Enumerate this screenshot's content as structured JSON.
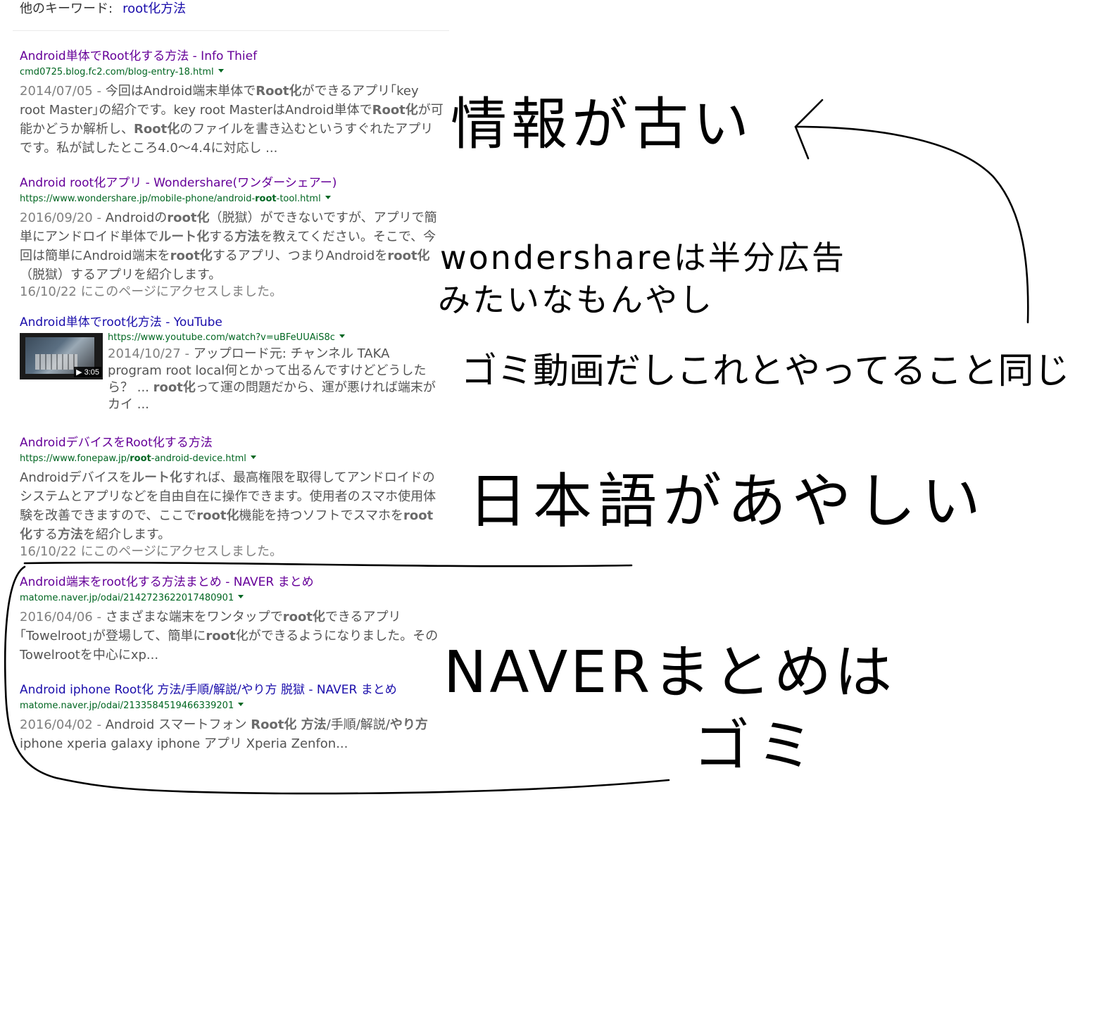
{
  "related_searches": {
    "label": "他のキーワード:",
    "link": "root化方法"
  },
  "results": [
    {
      "title": "Android単体でRoot化する方法 - Info Thief",
      "url": "cmd0725.blog.fc2.com/blog-entry-18.html",
      "date": "2014/07/05 -",
      "snippet_parts": [
        "今回はAndroid端末単体で",
        "Root化",
        "ができるアプリ｢key root Master｣の紹介です。key root MasterはAndroid単体で",
        "Root化",
        "が可能かどうか解析し、",
        "Root化",
        "のファイルを書き込むというすぐれたアプリです。私が試したところ4.0～4.4に対応し ..."
      ]
    },
    {
      "title": "Android root化アプリ - Wondershare(ワンダーシェアー)",
      "url_pre": "https://www.wondershare.jp/mobile-phone/android-",
      "url_bold": "root",
      "url_post": "-tool.html",
      "date": "2016/09/20 -",
      "snippet_parts": [
        "Androidの",
        "root化",
        "（脱獄）ができないですが、アプリで簡単にアンドロイド単体で",
        "ルート化",
        "する",
        "方法",
        "を教えてください。そこで、今回は簡単にAndroid端末を",
        "root化",
        "するアプリ、つまりAndroidを",
        "root化",
        "（脱獄）するアプリを紹介します。"
      ],
      "visited": "16/10/22 にこのページにアクセスしました。"
    },
    {
      "title": "Android単体でroot化方法 - YouTube",
      "url": "https://www.youtube.com/watch?v=uBFeUUAiS8c",
      "duration": "3:05",
      "date": "2014/10/27 -",
      "snippet_parts": [
        "アップロード元: チャンネル TAKA program root local何とかって出るんですけどどうしたら？ ... ",
        "root化",
        "って運の問題だから、運が悪ければ端末がカイ ..."
      ]
    },
    {
      "title": "AndroidデバイスをRoot化する方法",
      "url_pre": "https://www.fonepaw.jp/",
      "url_bold": "root",
      "url_post": "-android-device.html",
      "snippet_parts": [
        "Androidデバイスを",
        "ルート化",
        "すれば、最高権限を取得してアンドロイドのシステムとアプリなどを自由自在に操作できます。使用者のスマホ使用体験を改善できますので、ここで",
        "root化",
        "機能を持つソフトでスマホを",
        "root化",
        "する",
        "方法",
        "を紹介します。"
      ],
      "visited": "16/10/22 にこのページにアクセスしました。"
    },
    {
      "title": "Android端末をroot化する方法まとめ - NAVER まとめ",
      "url": "matome.naver.jp/odai/2142723622017480901",
      "date": "2016/04/06 -",
      "snippet_parts": [
        "さまざまな端末をワンタップで",
        "root化",
        "できるアプリ｢Towelroot｣が登場して、簡単に",
        "root",
        "化ができるようになりました。そのTowelrootを中心にxp..."
      ]
    },
    {
      "title": "Android iphone Root化 方法/手順/解説/やり方 脱獄 - NAVER まとめ",
      "url": "matome.naver.jp/odai/2133584519466339201",
      "date": "2016/04/02 -",
      "snippet_parts": [
        "Android スマートフォン ",
        "Root化 方法",
        "/手順/解説/",
        "やり方",
        " iphone xperia galaxy iphone アプリ Xperia Zenfon..."
      ]
    }
  ],
  "annotations": {
    "info_old": "情報が古い",
    "wondershare_line1": "wondershareは半分広告",
    "wondershare_line2": "みたいなもんやし",
    "youtube_note": "ゴミ動画だしこれとやってること同じ",
    "japanese_note": "日本語があやしい",
    "naver_line1": "NAVERまとめは",
    "naver_line2": "ゴミ"
  },
  "colors": {
    "title_link": "#1a0dab",
    "title_visited": "#660099",
    "url_green": "#006621",
    "snippet": "#545454",
    "date_gray": "#808080"
  }
}
